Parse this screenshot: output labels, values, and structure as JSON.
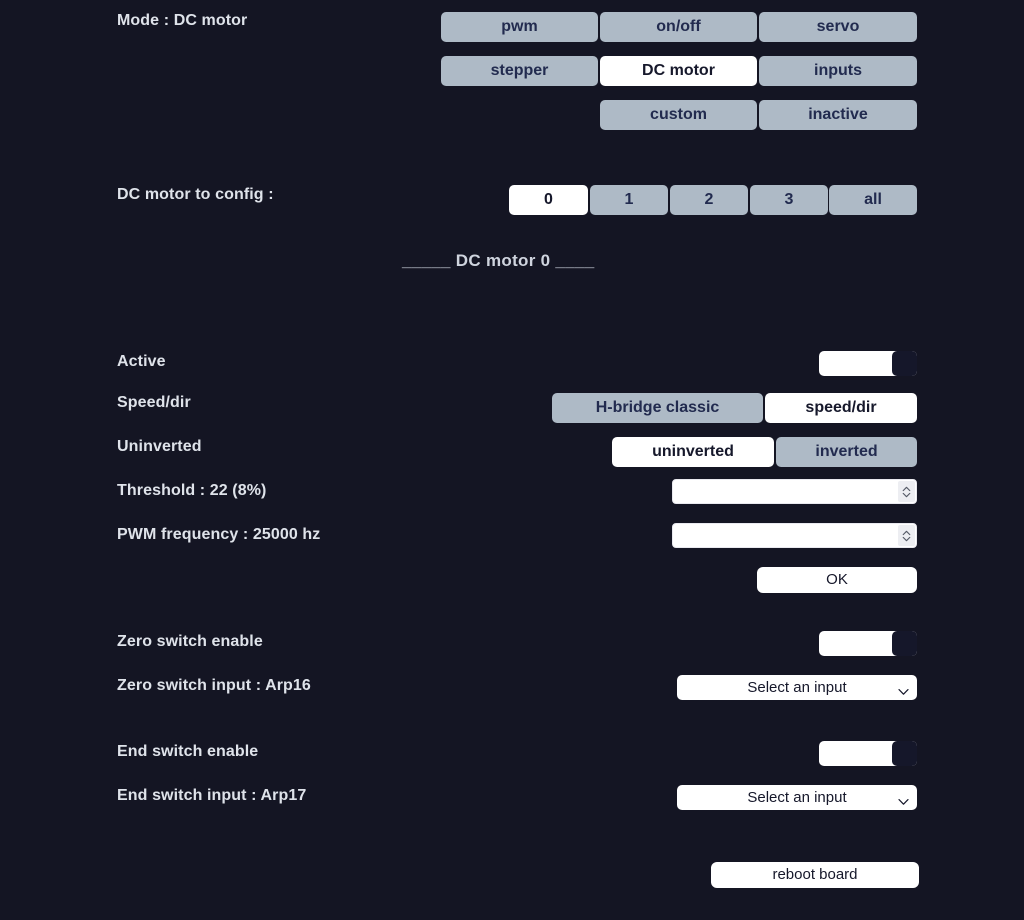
{
  "mode": {
    "label": "Mode : DC motor",
    "options": [
      {
        "label": "pwm",
        "selected": false
      },
      {
        "label": "on/off",
        "selected": false
      },
      {
        "label": "servo",
        "selected": false
      },
      {
        "label": "stepper",
        "selected": false
      },
      {
        "label": "DC motor",
        "selected": true
      },
      {
        "label": "inputs",
        "selected": false
      },
      {
        "label": "custom",
        "selected": false
      },
      {
        "label": "inactive",
        "selected": false
      }
    ]
  },
  "motor_select": {
    "label": "DC motor to config :",
    "options": [
      {
        "label": "0",
        "selected": true
      },
      {
        "label": "1",
        "selected": false
      },
      {
        "label": "2",
        "selected": false
      },
      {
        "label": "3",
        "selected": false
      },
      {
        "label": "all",
        "selected": false
      }
    ]
  },
  "section_title": "_____ DC motor 0 ____",
  "settings": {
    "active": {
      "label": "Active",
      "state": "on"
    },
    "speed_dir": {
      "label": "Speed/dir",
      "options": [
        {
          "label": "H-bridge classic",
          "selected": false
        },
        {
          "label": "speed/dir",
          "selected": true
        }
      ]
    },
    "inverted": {
      "label": "Uninverted",
      "options": [
        {
          "label": "uninverted",
          "selected": true
        },
        {
          "label": "inverted",
          "selected": false
        }
      ]
    },
    "threshold": {
      "label": "Threshold : 22 (8%)",
      "value": "",
      "placeholder": ""
    },
    "pwm_frequency": {
      "label": "PWM frequency : 25000 hz",
      "value": "",
      "placeholder": ""
    },
    "ok_button": "OK"
  },
  "zero_switch": {
    "enable_label": "Zero switch enable",
    "enable_state": "on",
    "input_label": "Zero switch input : Arp16",
    "input_value": "Select an input"
  },
  "end_switch": {
    "enable_label": "End switch enable",
    "enable_state": "on",
    "input_label": "End switch input : Arp17",
    "input_value": "Select an input"
  },
  "reboot_button": "reboot board",
  "colors": {
    "background": "#141523",
    "button_idle": "#aebac6",
    "button_selected": "#ffffff",
    "button_text": "#222b4f",
    "label_text": "#dfe3ea"
  }
}
